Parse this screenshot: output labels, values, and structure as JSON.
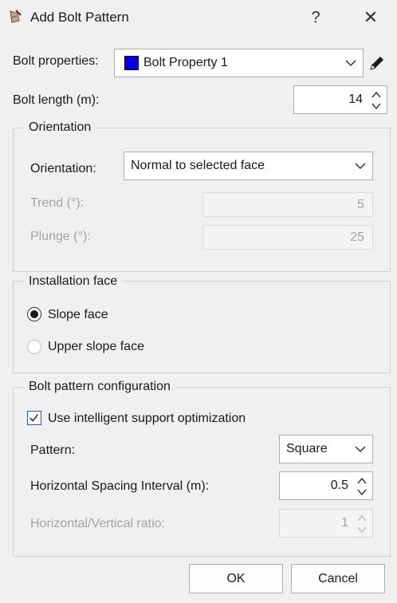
{
  "window": {
    "title": "Add Bolt Pattern",
    "help_label": "?",
    "close_label": "✕"
  },
  "bolt_properties": {
    "label": "Bolt properties:",
    "value": "Bolt Property 1",
    "swatch_color": "#0000e6"
  },
  "bolt_length": {
    "label": "Bolt length (m):",
    "value": "14"
  },
  "orientation_group": {
    "legend": "Orientation",
    "orientation_label": "Orientation:",
    "orientation_value": "Normal to selected face",
    "trend_label": "Trend (°):",
    "trend_value": "5",
    "plunge_label": "Plunge (°):",
    "plunge_value": "25"
  },
  "installation_group": {
    "legend": "Installation face",
    "option_slope": "Slope face",
    "option_upper": "Upper slope face",
    "selected": "Slope face"
  },
  "pattern_group": {
    "legend": "Bolt pattern configuration",
    "optimization_label": "Use intelligent support optimization",
    "optimization_checked": true,
    "pattern_label": "Pattern:",
    "pattern_value": "Square",
    "spacing_label": "Horizontal Spacing Interval (m):",
    "spacing_value": "0.5",
    "ratio_label": "Horizontal/Vertical ratio:",
    "ratio_value": "1"
  },
  "footer": {
    "ok_label": "OK",
    "cancel_label": "Cancel"
  },
  "icons": {
    "app": "bolt-app-icon",
    "edit": "pencil-icon"
  },
  "colors": {
    "checkbox_border": "#1a5fb4",
    "disabled_text": "#a3a3a3"
  }
}
